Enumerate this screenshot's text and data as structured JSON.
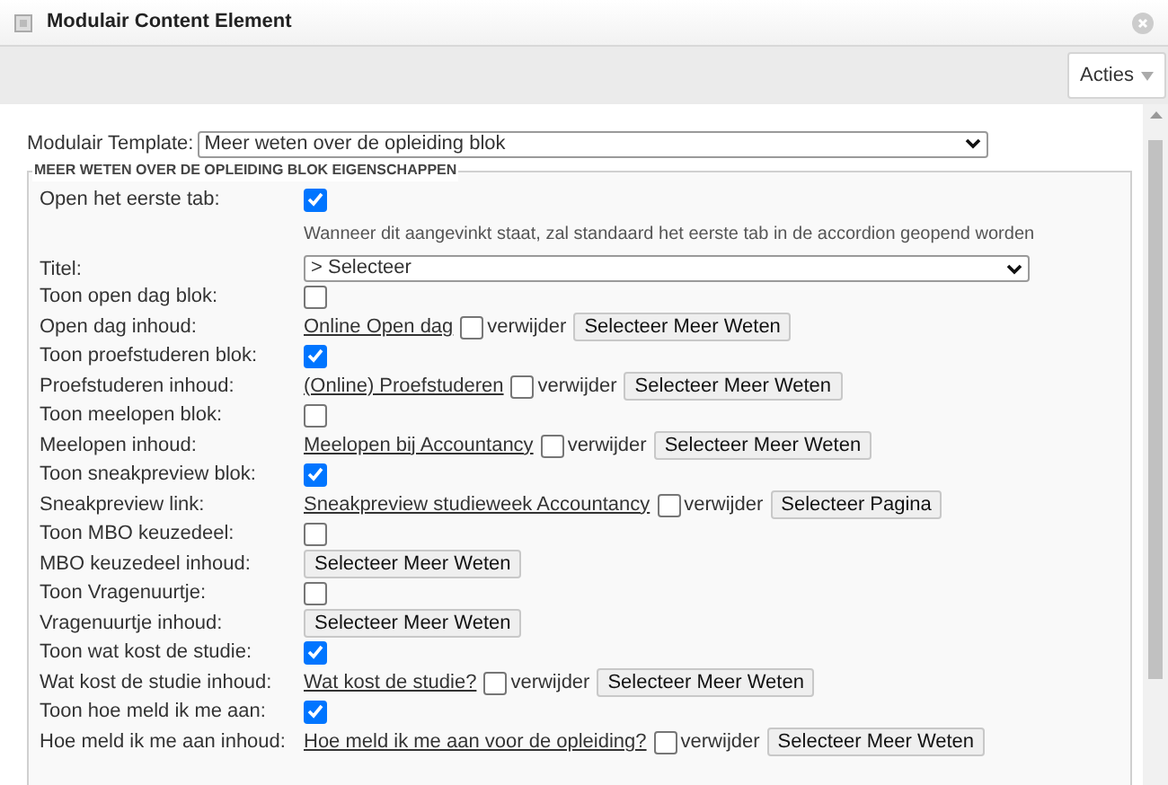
{
  "window": {
    "title": "Modulair Content Element"
  },
  "toolbar": {
    "actions_button": "Acties"
  },
  "template": {
    "label": "Modulair Template:",
    "value": "Meer weten over de opleiding blok"
  },
  "fieldset": {
    "legend": "MEER WETEN OVER DE OPLEIDING BLOK EIGENSCHAPPEN",
    "rows": [
      {
        "kind": "checkbox",
        "label": "Open het eerste tab:",
        "checked": true,
        "hint": "Wanneer dit aangevinkt staat, zal standaard het eerste tab in de accordion geopend worden"
      },
      {
        "kind": "select",
        "label": "Titel:",
        "value": "> Selecteer"
      },
      {
        "kind": "checkbox",
        "label": "Toon open dag blok:",
        "checked": false
      },
      {
        "kind": "link",
        "label": "Open dag inhoud:",
        "link": "Online Open dag",
        "remove_label": "verwijder",
        "remove_checked": false,
        "button": "Selecteer Meer Weten"
      },
      {
        "kind": "checkbox",
        "label": "Toon proefstuderen blok:",
        "checked": true
      },
      {
        "kind": "link",
        "label": "Proefstuderen inhoud:",
        "link": "(Online) Proefstuderen",
        "remove_label": "verwijder",
        "remove_checked": false,
        "button": "Selecteer Meer Weten"
      },
      {
        "kind": "checkbox",
        "label": "Toon meelopen blok:",
        "checked": false
      },
      {
        "kind": "link",
        "label": "Meelopen inhoud:",
        "link": "Meelopen bij Accountancy",
        "remove_label": "verwijder",
        "remove_checked": false,
        "button": "Selecteer Meer Weten"
      },
      {
        "kind": "checkbox",
        "label": "Toon sneakpreview blok:",
        "checked": true
      },
      {
        "kind": "link",
        "label": "Sneakpreview link:",
        "link": "Sneakpreview studieweek Accountancy",
        "remove_label": "verwijder",
        "remove_checked": false,
        "button": "Selecteer Pagina"
      },
      {
        "kind": "checkbox",
        "label": "Toon MBO keuzedeel:",
        "checked": false
      },
      {
        "kind": "button",
        "label": "MBO keuzedeel inhoud:",
        "button": "Selecteer Meer Weten"
      },
      {
        "kind": "checkbox",
        "label": "Toon Vragenuurtje:",
        "checked": false
      },
      {
        "kind": "button",
        "label": "Vragenuurtje inhoud:",
        "button": "Selecteer Meer Weten"
      },
      {
        "kind": "checkbox",
        "label": "Toon wat kost de studie:",
        "checked": true
      },
      {
        "kind": "link",
        "label": "Wat kost de studie inhoud:",
        "link": "Wat kost de studie?",
        "remove_label": "verwijder",
        "remove_checked": false,
        "button": "Selecteer Meer Weten"
      },
      {
        "kind": "checkbox",
        "label": "Toon hoe meld ik me aan:",
        "checked": true
      },
      {
        "kind": "link",
        "label": "Hoe meld ik me aan inhoud:",
        "link": "Hoe meld ik me aan voor de opleiding?",
        "remove_label": "verwijder",
        "remove_checked": false,
        "button": "Selecteer Meer Weten"
      }
    ]
  }
}
